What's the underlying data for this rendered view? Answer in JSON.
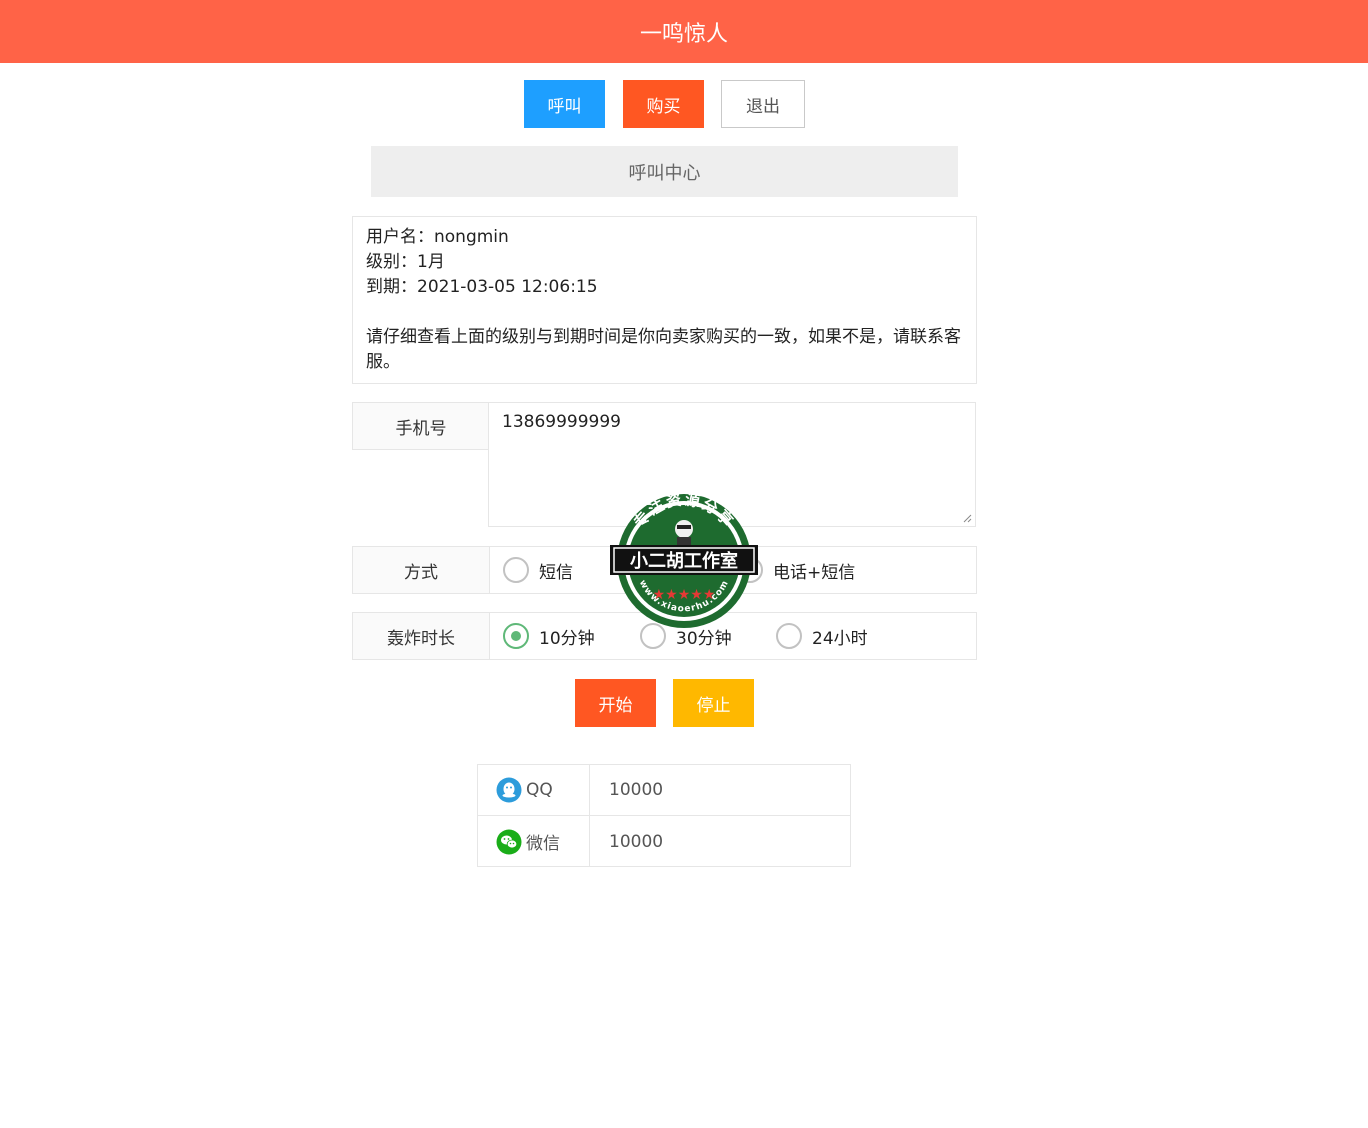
{
  "header": {
    "title": "一鸣惊人"
  },
  "nav": {
    "call_label": "呼叫",
    "buy_label": "购买",
    "exit_label": "退出"
  },
  "section": {
    "title": "呼叫中心"
  },
  "account": {
    "username_label": "用户名：",
    "username": "nongmin",
    "level_label": "级别：",
    "level": "1月",
    "expiry_label": "到期：",
    "expiry": "2021-03-05 12:06:15",
    "notice": "请仔细查看上面的级别与到期时间是你向卖家购买的一致，如果不是，请联系客服。"
  },
  "form": {
    "phone_label": "手机号",
    "phone_value": "13869999999",
    "mode_label": "方式",
    "mode_options": [
      "短信",
      "电话+短信"
    ],
    "mode_selected": "",
    "duration_label": "轰炸时长",
    "duration_options": [
      "10分钟",
      "30分钟",
      "24小时"
    ],
    "duration_selected": "10分钟"
  },
  "actions": {
    "start_label": "开始",
    "stop_label": "停止"
  },
  "contacts": [
    {
      "label": "QQ",
      "value": "10000",
      "icon": "qq-icon"
    },
    {
      "label": "微信",
      "value": "10000",
      "icon": "wechat-icon"
    }
  ],
  "watermark": {
    "top_text": "专注资源分享",
    "center_text": "小二胡工作室",
    "bottom_text": "www.xiaoerhu.com"
  },
  "colors": {
    "header": "#ff6347",
    "blue": "#1e9fff",
    "orange": "#ff5722",
    "yellow": "#ffb800",
    "radio_checked": "#5fb878"
  }
}
